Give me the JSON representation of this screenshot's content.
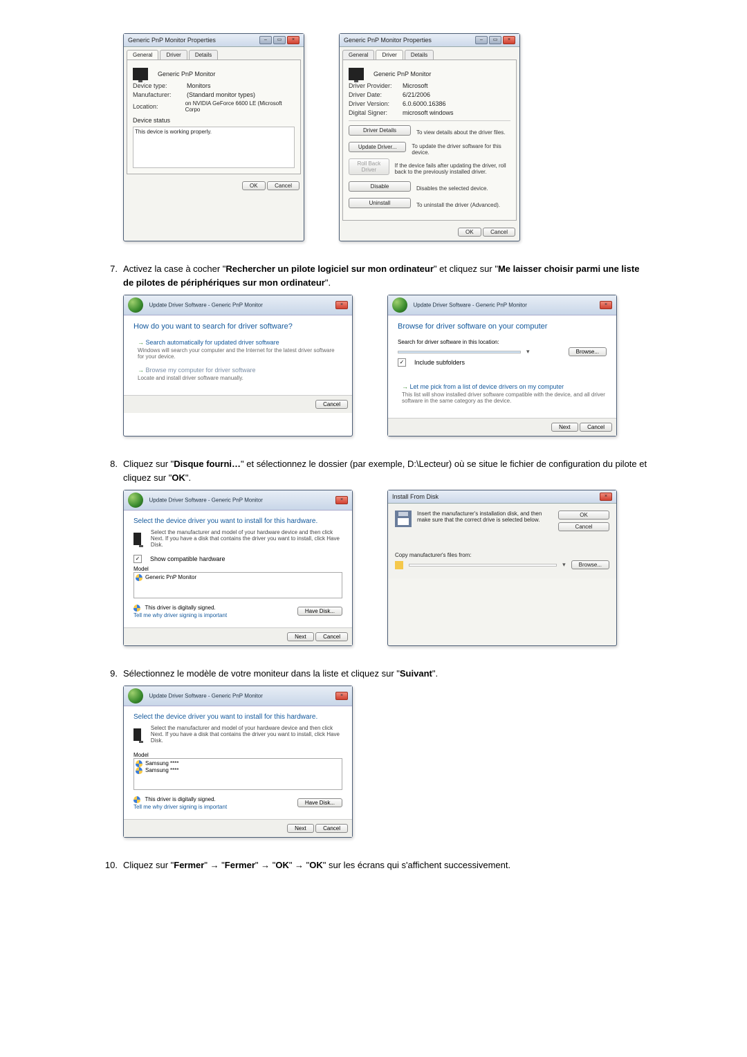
{
  "step7": {
    "num": "7.",
    "pre": "Activez la case à cocher \"",
    "bold1": "Rechercher un pilote logiciel sur mon ordinateur",
    "mid1": "\" et cliquez sur \"",
    "bold2": "Me laisser choisir parmi une liste de pilotes de périphériques sur mon ordinateur",
    "post": "\"."
  },
  "step8": {
    "num": "8.",
    "pre": "Cliquez sur \"",
    "bold1": "Disque fourni…",
    "mid1": "\" et sélectionnez le dossier (par exemple, D:\\Lecteur) où se situe le fichier de configuration du pilote et cliquez sur \"",
    "bold2": "OK",
    "post": "\"."
  },
  "step9": {
    "num": "9.",
    "pre": "Sélectionnez le modèle de votre moniteur dans la liste et cliquez sur \"",
    "bold1": "Suivant",
    "post": "\"."
  },
  "step10": {
    "num": "10.",
    "pre": "Cliquez sur \"",
    "bold1": "Fermer",
    "arrow": "\" → \"",
    "bold2": "Fermer",
    "bold3": "OK",
    "bold4": "OK",
    "post": "\" sur les écrans qui s'affichent successivement."
  },
  "dlgA": {
    "title": "Generic PnP Monitor Properties",
    "tab_general": "General",
    "tab_driver": "Driver",
    "tab_details": "Details",
    "name": "Generic PnP Monitor",
    "devType_l": "Device type:",
    "devType_v": "Monitors",
    "manuf_l": "Manufacturer:",
    "manuf_v": "(Standard monitor types)",
    "loc_l": "Location:",
    "loc_v": "on NVIDIA GeForce 6600 LE (Microsoft Corpo",
    "status_l": "Device status",
    "status_v": "This device is working properly.",
    "ok": "OK",
    "cancel": "Cancel"
  },
  "dlgB": {
    "title": "Generic PnP Monitor Properties",
    "provider_l": "Driver Provider:",
    "provider_v": "Microsoft",
    "date_l": "Driver Date:",
    "date_v": "6/21/2006",
    "ver_l": "Driver Version:",
    "ver_v": "6.0.6000.16386",
    "signer_l": "Digital Signer:",
    "signer_v": "microsoft windows",
    "b_details": "Driver Details",
    "b_details_d": "To view details about the driver files.",
    "b_update": "Update Driver...",
    "b_update_d": "To update the driver software for this device.",
    "b_roll": "Roll Back Driver",
    "b_roll_d": "If the device fails after updating the driver, roll back to the previously installed driver.",
    "b_disable": "Disable",
    "b_disable_d": "Disables the selected device.",
    "b_uninst": "Uninstall",
    "b_uninst_d": "To uninstall the driver (Advanced).",
    "ok": "OK",
    "cancel": "Cancel"
  },
  "wizA": {
    "title": "Update Driver Software - Generic PnP Monitor",
    "heading": "How do you want to search for driver software?",
    "opt1_t": "Search automatically for updated driver software",
    "opt1_d": "Windows will search your computer and the Internet for the latest driver software for your device.",
    "opt2_t": "Browse my computer for driver software",
    "opt2_d": "Locate and install driver software manually.",
    "cancel": "Cancel"
  },
  "wizB": {
    "title": "Update Driver Software - Generic PnP Monitor",
    "heading": "Browse for driver software on your computer",
    "search_l": "Search for driver software in this location:",
    "browse": "Browse...",
    "include": "Include subfolders",
    "opt_t": "Let me pick from a list of device drivers on my computer",
    "opt_d": "This list will show installed driver software compatible with the device, and all driver software in the same category as the device.",
    "next": "Next",
    "cancel": "Cancel"
  },
  "wizC": {
    "title": "Update Driver Software - Generic PnP Monitor",
    "heading": "Select the device driver you want to install for this hardware.",
    "instr": "Select the manufacturer and model of your hardware device and then click Next. If you have a disk that contains the driver you want to install, click Have Disk.",
    "compat": "Show compatible hardware",
    "model_l": "Model",
    "model_v": "Generic PnP Monitor",
    "signed": "This driver is digitally signed.",
    "tell": "Tell me why driver signing is important",
    "havedisk": "Have Disk...",
    "next": "Next",
    "cancel": "Cancel"
  },
  "ifd": {
    "title": "Install From Disk",
    "msg1": "Insert the manufacturer's installation disk, and then make sure that the correct drive is selected below.",
    "copy": "Copy manufacturer's files from:",
    "ok": "OK",
    "cancel": "Cancel",
    "browse": "Browse..."
  },
  "wizD": {
    "title": "Update Driver Software - Generic PnP Monitor",
    "heading": "Select the device driver you want to install for this hardware.",
    "instr": "Select the manufacturer and model of your hardware device and then click Next. If you have a disk that contains the driver you want to install, click Have Disk.",
    "model_l": "Model",
    "m1": "Samsung ****",
    "m2": "Samsung ****",
    "signed": "This driver is digitally signed.",
    "tell": "Tell me why driver signing is important",
    "havedisk": "Have Disk...",
    "next": "Next",
    "cancel": "Cancel"
  }
}
